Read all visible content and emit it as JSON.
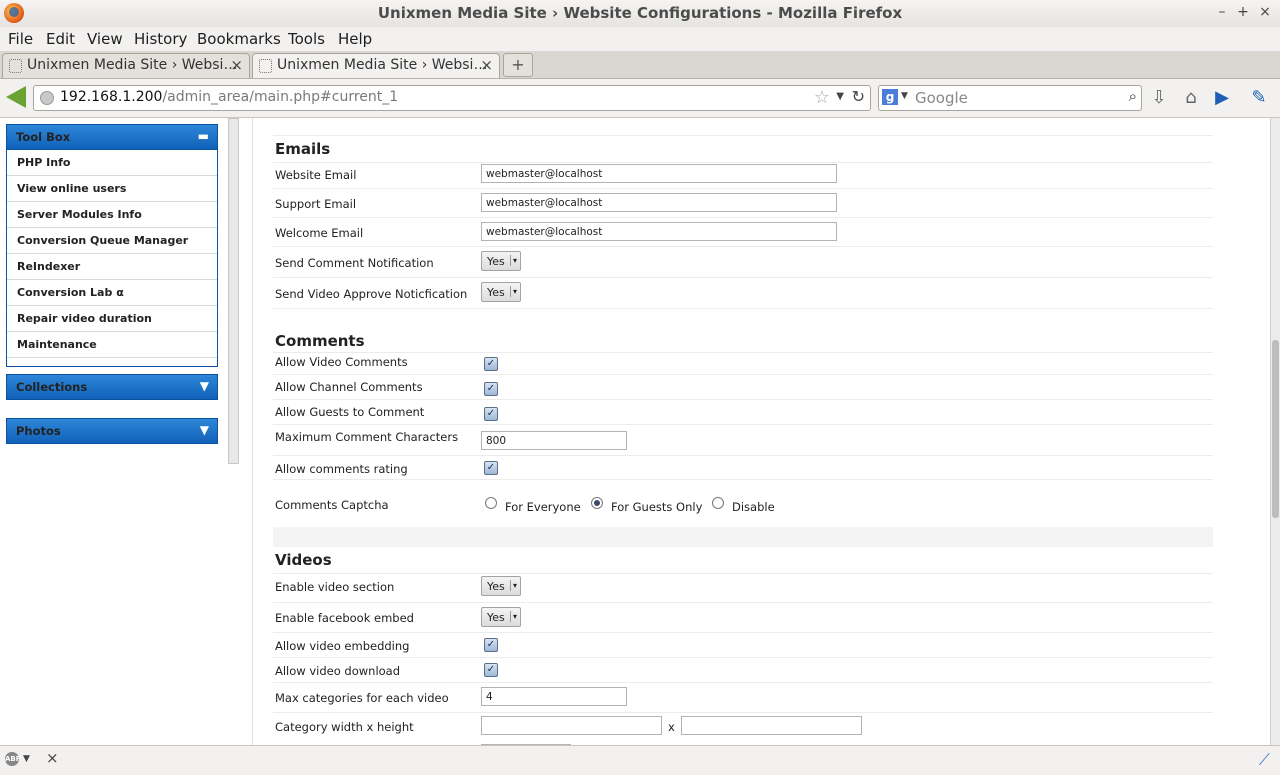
{
  "window": {
    "title": "Unixmen Media Site › Website Configurations - Mozilla Firefox"
  },
  "menu": [
    "File",
    "Edit",
    "View",
    "History",
    "Bookmarks",
    "Tools",
    "Help"
  ],
  "tabs": [
    {
      "label": "Unixmen Media Site › Websi…",
      "active": false
    },
    {
      "label": "Unixmen Media Site › Websi…",
      "active": true
    }
  ],
  "nav": {
    "url_host": "192.168.1.200",
    "url_path": "/admin_area/main.php#current_1",
    "search_placeholder": "Google"
  },
  "sidebar": {
    "toolbox_title": "Tool Box",
    "toolbox_items": [
      "PHP Info",
      "View online users",
      "Server Modules Info",
      "Conversion Queue Manager",
      "ReIndexer",
      "Conversion Lab α",
      "Repair video duration",
      "Maintenance"
    ],
    "collections_title": "Collections",
    "photos_title": "Photos"
  },
  "emails": {
    "title": "Emails",
    "website_label": "Website Email",
    "website_value": "webmaster@localhost",
    "support_label": "Support Email",
    "support_value": "webmaster@localhost",
    "welcome_label": "Welcome Email",
    "welcome_value": "webmaster@localhost",
    "send_comment_label": "Send Comment Notification",
    "send_comment_value": "Yes",
    "send_video_label": "Send Video Approve Noticfication",
    "send_video_value": "Yes"
  },
  "comments": {
    "title": "Comments",
    "allow_video_label": "Allow Video Comments",
    "allow_channel_label": "Allow Channel Comments",
    "allow_guests_label": "Allow Guests to Comment",
    "max_chars_label": "Maximum Comment Characters",
    "max_chars_value": "800",
    "allow_rating_label": "Allow comments rating",
    "captcha_label": "Comments Captcha",
    "captcha_options": [
      "For Everyone",
      "For Guests Only",
      "Disable"
    ],
    "captcha_selected": "For Guests Only"
  },
  "videos": {
    "title": "Videos",
    "enable_section_label": "Enable video section",
    "enable_section_value": "Yes",
    "enable_fb_label": "Enable facebook embed",
    "enable_fb_value": "Yes",
    "allow_embed_label": "Allow video embedding",
    "allow_download_label": "Allow video download",
    "max_categories_label": "Max categories for each video",
    "max_categories_value": "4",
    "cat_size_label": "Category width x height",
    "cat_size_sep": "x"
  }
}
